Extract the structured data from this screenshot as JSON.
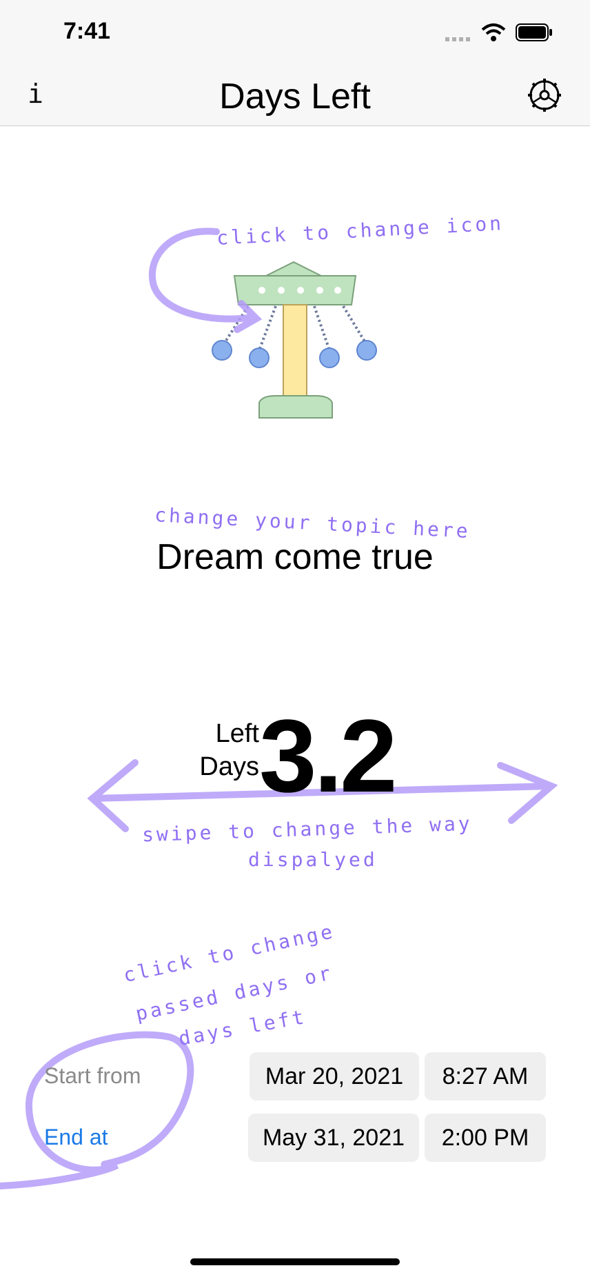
{
  "status": {
    "time": "7:41"
  },
  "nav": {
    "title": "Days Left",
    "info_label": "i"
  },
  "annotations": {
    "icon_hint": "click to change icon",
    "topic_hint": "change your topic here",
    "swipe_hint_1": "swipe to change the way",
    "swipe_hint_2": "dispalyed",
    "mode_hint_1": "click to change",
    "mode_hint_2": "passed days or",
    "mode_hint_3": "days left"
  },
  "topic": "Dream come true",
  "counter": {
    "label_1": "Left",
    "label_2": "Days",
    "value": "3.2"
  },
  "start": {
    "label": "Start from",
    "date": "Mar 20, 2021",
    "time": "8:27 AM"
  },
  "end": {
    "label": "End at",
    "date": "May 31, 2021",
    "time": "2:00 PM"
  },
  "colors": {
    "accent": "#1a7ae6",
    "annotation": "#8f6ff2",
    "muted": "#8a8a8a"
  }
}
